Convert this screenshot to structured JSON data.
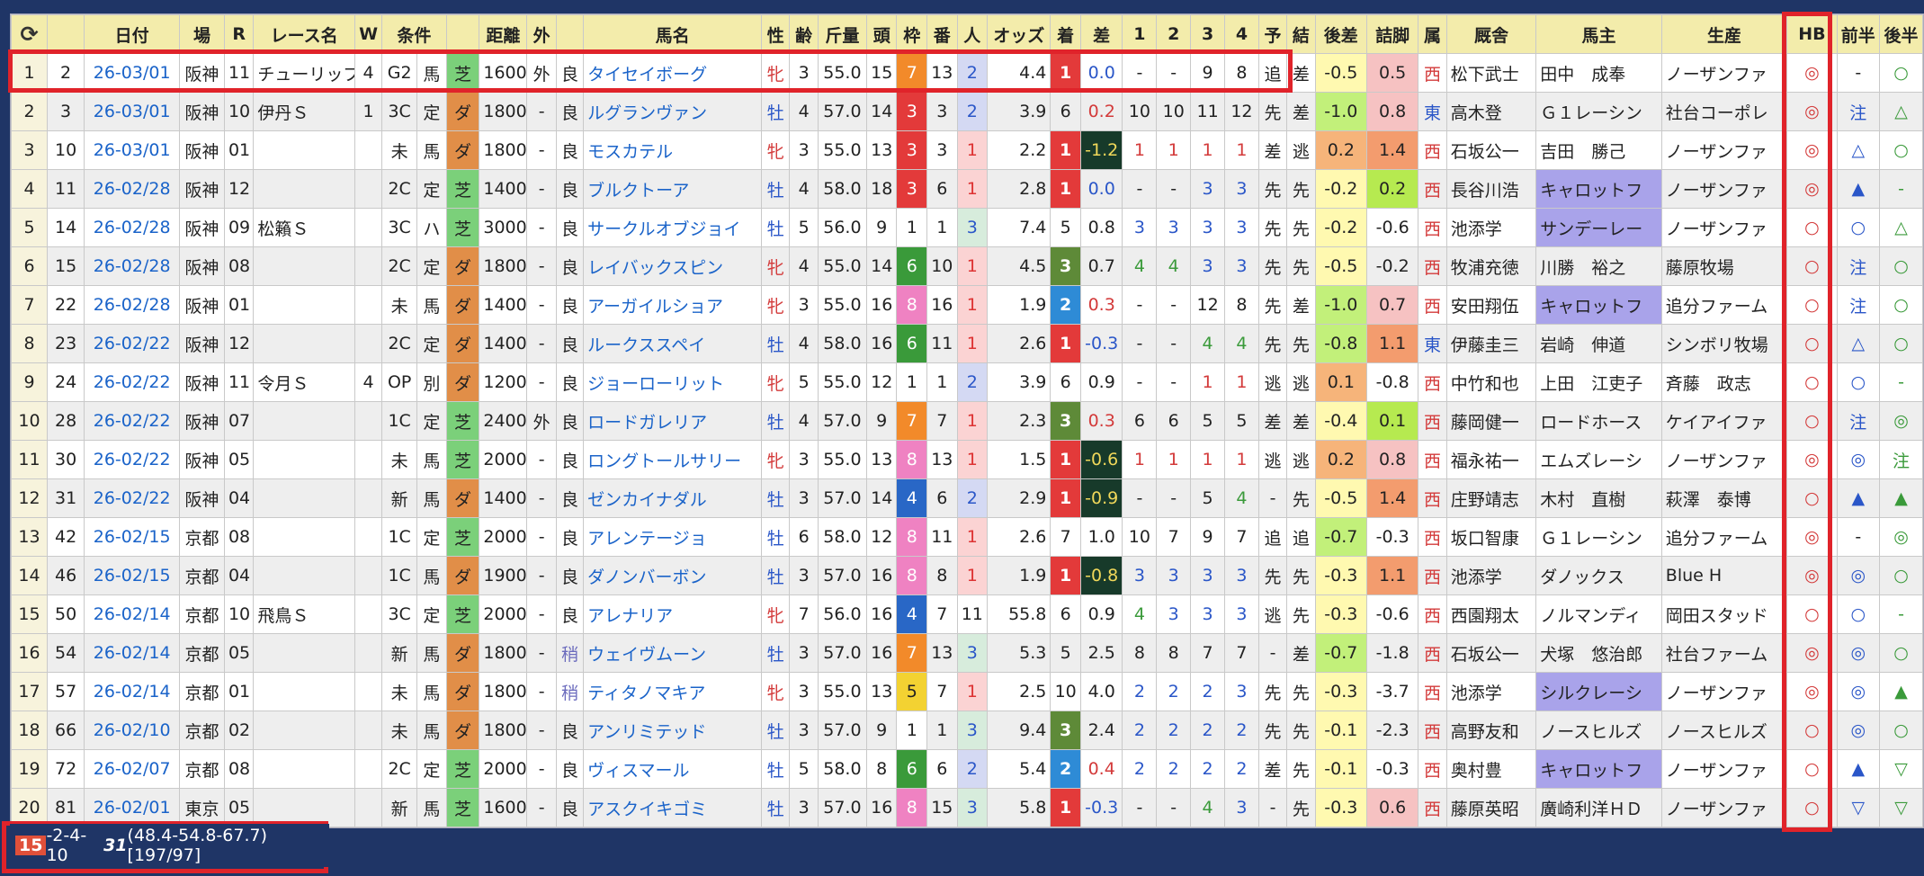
{
  "header": {
    "refresh_icon": "refresh-icon",
    "columns": [
      "日付",
      "場",
      "R",
      "レース名",
      "W",
      "条件",
      "",
      "距離",
      "外",
      "",
      "馬名",
      "性",
      "齢",
      "斤量",
      "頭",
      "枠",
      "番",
      "人",
      "オッズ",
      "着",
      "差",
      "1",
      "2",
      "3",
      "4",
      "予",
      "結",
      "後差",
      "詰脚",
      "属",
      "厩舎",
      "馬主",
      "生産",
      "HB",
      "前半",
      "後半"
    ]
  },
  "rows": [
    {
      "no": "1",
      "id": "2",
      "date": "26-03/01",
      "track": "阪神",
      "r": "11",
      "race": "チューリップ",
      "w": "4",
      "cls": "G2",
      "cond": "馬",
      "surf": "芝",
      "dist": "1600",
      "out": "外",
      "going": "良",
      "horse": "タイセイボーグ",
      "sex": "牝",
      "age": "3",
      "kin": "55.0",
      "heads": "15",
      "frame": "7",
      "num": "13",
      "pop": "2",
      "odds": "4.4",
      "fin": "1",
      "diff": "0.0",
      "p1": "-",
      "p2": "-",
      "p3": "9",
      "p4": "8",
      "yo": "追",
      "ke": "差",
      "kohsa": "-0.5",
      "tsume": "0.5",
      "zoku": "西",
      "stable": "松下武士",
      "owner": "田中　成奉",
      "breeder": "ノーザンファ",
      "hb": "◎",
      "zen": "-",
      "kou": "○"
    },
    {
      "no": "2",
      "id": "3",
      "date": "26-03/01",
      "track": "阪神",
      "r": "10",
      "race": "伊丹Ｓ",
      "w": "1",
      "cls": "3C",
      "cond": "定",
      "surf": "ダ",
      "dist": "1800",
      "out": "-",
      "going": "良",
      "horse": "ルグランヴァン",
      "sex": "牡",
      "age": "4",
      "kin": "57.0",
      "heads": "14",
      "frame": "3",
      "num": "3",
      "pop": "2",
      "odds": "3.9",
      "fin": "6",
      "diff": "0.2",
      "p1": "10",
      "p2": "10",
      "p3": "11",
      "p4": "12",
      "yo": "先",
      "ke": "差",
      "kohsa": "-1.0",
      "tsume": "0.8",
      "zoku": "東",
      "stable": "高木登",
      "owner": "Ｇ１レーシン",
      "breeder": "社台コーポレ",
      "hb": "◎",
      "zen": "注",
      "kou": "△"
    },
    {
      "no": "3",
      "id": "10",
      "date": "26-03/01",
      "track": "阪神",
      "r": "01",
      "race": "",
      "w": "",
      "cls": "未",
      "cond": "馬",
      "surf": "ダ",
      "dist": "1800",
      "out": "-",
      "going": "良",
      "horse": "モスカテル",
      "sex": "牝",
      "age": "3",
      "kin": "55.0",
      "heads": "13",
      "frame": "3",
      "num": "3",
      "pop": "1",
      "odds": "2.2",
      "fin": "1",
      "diff": "-1.2",
      "p1": "1",
      "p2": "1",
      "p3": "1",
      "p4": "1",
      "yo": "差",
      "ke": "逃",
      "kohsa": "0.2",
      "tsume": "1.4",
      "zoku": "西",
      "stable": "石坂公一",
      "owner": "吉田　勝己",
      "breeder": "ノーザンファ",
      "hb": "◎",
      "zen": "△",
      "kou": "○"
    },
    {
      "no": "4",
      "id": "11",
      "date": "26-02/28",
      "track": "阪神",
      "r": "12",
      "race": "",
      "w": "",
      "cls": "2C",
      "cond": "定",
      "surf": "芝",
      "dist": "1400",
      "out": "-",
      "going": "良",
      "horse": "ブルクトーア",
      "sex": "牡",
      "age": "4",
      "kin": "58.0",
      "heads": "18",
      "frame": "3",
      "num": "6",
      "pop": "1",
      "odds": "2.8",
      "fin": "1",
      "diff": "0.0",
      "p1": "-",
      "p2": "-",
      "p3": "3",
      "p4": "3",
      "yo": "先",
      "ke": "先",
      "kohsa": "-0.2",
      "tsume": "0.2",
      "zoku": "西",
      "stable": "長谷川浩",
      "owner": "キャロットフ",
      "breeder": "ノーザンファ",
      "hb": "◎",
      "zen": "▲",
      "kou": "-"
    },
    {
      "no": "5",
      "id": "14",
      "date": "26-02/28",
      "track": "阪神",
      "r": "09",
      "race": "松籟Ｓ",
      "w": "",
      "cls": "3C",
      "cond": "ハ",
      "surf": "芝",
      "dist": "3000",
      "out": "-",
      "going": "良",
      "horse": "サークルオブジョイ",
      "sex": "牡",
      "age": "5",
      "kin": "56.0",
      "heads": "9",
      "frame": "1",
      "num": "1",
      "pop": "3",
      "odds": "7.4",
      "fin": "5",
      "diff": "0.8",
      "p1": "3",
      "p2": "3",
      "p3": "3",
      "p4": "3",
      "yo": "先",
      "ke": "先",
      "kohsa": "-0.2",
      "tsume": "-0.6",
      "zoku": "西",
      "stable": "池添学",
      "owner": "サンデーレー",
      "breeder": "ノーザンファ",
      "hb": "○",
      "zen": "○",
      "kou": "△"
    },
    {
      "no": "6",
      "id": "15",
      "date": "26-02/28",
      "track": "阪神",
      "r": "08",
      "race": "",
      "w": "",
      "cls": "2C",
      "cond": "定",
      "surf": "ダ",
      "dist": "1800",
      "out": "-",
      "going": "良",
      "horse": "レイバックスピン",
      "sex": "牝",
      "age": "4",
      "kin": "55.0",
      "heads": "14",
      "frame": "6",
      "num": "10",
      "pop": "1",
      "odds": "4.5",
      "fin": "3",
      "diff": "0.7",
      "p1": "4",
      "p2": "4",
      "p3": "3",
      "p4": "3",
      "yo": "先",
      "ke": "先",
      "kohsa": "-0.5",
      "tsume": "-0.2",
      "zoku": "西",
      "stable": "牧浦充徳",
      "owner": "川勝　裕之",
      "breeder": "藤原牧場",
      "hb": "○",
      "zen": "注",
      "kou": "○"
    },
    {
      "no": "7",
      "id": "22",
      "date": "26-02/28",
      "track": "阪神",
      "r": "01",
      "race": "",
      "w": "",
      "cls": "未",
      "cond": "馬",
      "surf": "ダ",
      "dist": "1400",
      "out": "-",
      "going": "良",
      "horse": "アーガイルショア",
      "sex": "牝",
      "age": "3",
      "kin": "55.0",
      "heads": "16",
      "frame": "8",
      "num": "16",
      "pop": "1",
      "odds": "1.9",
      "fin": "2",
      "diff": "0.3",
      "p1": "-",
      "p2": "-",
      "p3": "12",
      "p4": "8",
      "yo": "先",
      "ke": "差",
      "kohsa": "-1.0",
      "tsume": "0.7",
      "zoku": "西",
      "stable": "安田翔伍",
      "owner": "キャロットフ",
      "breeder": "追分ファーム",
      "hb": "○",
      "zen": "注",
      "kou": "○"
    },
    {
      "no": "8",
      "id": "23",
      "date": "26-02/22",
      "track": "阪神",
      "r": "12",
      "race": "",
      "w": "",
      "cls": "2C",
      "cond": "定",
      "surf": "ダ",
      "dist": "1400",
      "out": "-",
      "going": "良",
      "horse": "ルークススペイ",
      "sex": "牡",
      "age": "4",
      "kin": "58.0",
      "heads": "16",
      "frame": "6",
      "num": "11",
      "pop": "1",
      "odds": "2.6",
      "fin": "1",
      "diff": "-0.3",
      "p1": "-",
      "p2": "-",
      "p3": "4",
      "p4": "4",
      "yo": "先",
      "ke": "先",
      "kohsa": "-0.8",
      "tsume": "1.1",
      "zoku": "東",
      "stable": "伊藤圭三",
      "owner": "岩崎　伸道",
      "breeder": "シンボリ牧場",
      "hb": "○",
      "zen": "△",
      "kou": "○"
    },
    {
      "no": "9",
      "id": "24",
      "date": "26-02/22",
      "track": "阪神",
      "r": "11",
      "race": "令月Ｓ",
      "w": "4",
      "cls": "OP",
      "cond": "別",
      "surf": "ダ",
      "dist": "1200",
      "out": "-",
      "going": "良",
      "horse": "ジョーローリット",
      "sex": "牝",
      "age": "5",
      "kin": "55.0",
      "heads": "12",
      "frame": "1",
      "num": "1",
      "pop": "2",
      "odds": "3.9",
      "fin": "6",
      "diff": "0.9",
      "p1": "-",
      "p2": "-",
      "p3": "1",
      "p4": "1",
      "yo": "逃",
      "ke": "逃",
      "kohsa": "0.1",
      "tsume": "-0.8",
      "zoku": "西",
      "stable": "中竹和也",
      "owner": "上田　江吏子",
      "breeder": "斉藤　政志",
      "hb": "○",
      "zen": "○",
      "kou": "-"
    },
    {
      "no": "10",
      "id": "28",
      "date": "26-02/22",
      "track": "阪神",
      "r": "07",
      "race": "",
      "w": "",
      "cls": "1C",
      "cond": "定",
      "surf": "芝",
      "dist": "2400",
      "out": "外",
      "going": "良",
      "horse": "ロードガレリア",
      "sex": "牡",
      "age": "4",
      "kin": "57.0",
      "heads": "9",
      "frame": "7",
      "num": "7",
      "pop": "1",
      "odds": "2.3",
      "fin": "3",
      "diff": "0.3",
      "p1": "6",
      "p2": "6",
      "p3": "5",
      "p4": "5",
      "yo": "差",
      "ke": "差",
      "kohsa": "-0.4",
      "tsume": "0.1",
      "zoku": "西",
      "stable": "藤岡健一",
      "owner": "ロードホース",
      "breeder": "ケイアイファ",
      "hb": "○",
      "zen": "注",
      "kou": "◎"
    },
    {
      "no": "11",
      "id": "30",
      "date": "26-02/22",
      "track": "阪神",
      "r": "05",
      "race": "",
      "w": "",
      "cls": "未",
      "cond": "馬",
      "surf": "芝",
      "dist": "2000",
      "out": "-",
      "going": "良",
      "horse": "ロングトールサリー",
      "sex": "牝",
      "age": "3",
      "kin": "55.0",
      "heads": "13",
      "frame": "8",
      "num": "13",
      "pop": "1",
      "odds": "1.5",
      "fin": "1",
      "diff": "-0.6",
      "p1": "1",
      "p2": "1",
      "p3": "1",
      "p4": "1",
      "yo": "逃",
      "ke": "逃",
      "kohsa": "0.2",
      "tsume": "0.8",
      "zoku": "西",
      "stable": "福永祐一",
      "owner": "エムズレーシ",
      "breeder": "ノーザンファ",
      "hb": "◎",
      "zen": "◎",
      "kou": "注"
    },
    {
      "no": "12",
      "id": "31",
      "date": "26-02/22",
      "track": "阪神",
      "r": "04",
      "race": "",
      "w": "",
      "cls": "新",
      "cond": "馬",
      "surf": "ダ",
      "dist": "1400",
      "out": "-",
      "going": "良",
      "horse": "ゼンカイナダル",
      "sex": "牡",
      "age": "3",
      "kin": "57.0",
      "heads": "14",
      "frame": "4",
      "num": "6",
      "pop": "2",
      "odds": "2.9",
      "fin": "1",
      "diff": "-0.9",
      "p1": "-",
      "p2": "-",
      "p3": "5",
      "p4": "4",
      "yo": "-",
      "ke": "先",
      "kohsa": "-0.5",
      "tsume": "1.4",
      "zoku": "西",
      "stable": "庄野靖志",
      "owner": "木村　直樹",
      "breeder": "萩澤　泰博",
      "hb": "○",
      "zen": "▲",
      "kou": "▲"
    },
    {
      "no": "13",
      "id": "42",
      "date": "26-02/15",
      "track": "京都",
      "r": "08",
      "race": "",
      "w": "",
      "cls": "1C",
      "cond": "定",
      "surf": "芝",
      "dist": "2000",
      "out": "-",
      "going": "良",
      "horse": "アレンテージョ",
      "sex": "牡",
      "age": "6",
      "kin": "58.0",
      "heads": "12",
      "frame": "8",
      "num": "11",
      "pop": "1",
      "odds": "2.6",
      "fin": "7",
      "diff": "1.0",
      "p1": "10",
      "p2": "7",
      "p3": "9",
      "p4": "7",
      "yo": "追",
      "ke": "追",
      "kohsa": "-0.7",
      "tsume": "-0.3",
      "zoku": "西",
      "stable": "坂口智康",
      "owner": "Ｇ１レーシン",
      "breeder": "追分ファーム",
      "hb": "◎",
      "zen": "-",
      "kou": "◎"
    },
    {
      "no": "14",
      "id": "46",
      "date": "26-02/15",
      "track": "京都",
      "r": "04",
      "race": "",
      "w": "",
      "cls": "1C",
      "cond": "馬",
      "surf": "ダ",
      "dist": "1900",
      "out": "-",
      "going": "良",
      "horse": "ダノンバーボン",
      "sex": "牡",
      "age": "3",
      "kin": "57.0",
      "heads": "16",
      "frame": "8",
      "num": "8",
      "pop": "1",
      "odds": "1.9",
      "fin": "1",
      "diff": "-0.8",
      "p1": "3",
      "p2": "3",
      "p3": "3",
      "p4": "3",
      "yo": "先",
      "ke": "先",
      "kohsa": "-0.3",
      "tsume": "1.1",
      "zoku": "西",
      "stable": "池添学",
      "owner": "ダノックス",
      "breeder": "Blue H",
      "hb": "◎",
      "zen": "◎",
      "kou": "○"
    },
    {
      "no": "15",
      "id": "50",
      "date": "26-02/14",
      "track": "京都",
      "r": "10",
      "race": "飛鳥Ｓ",
      "w": "",
      "cls": "3C",
      "cond": "定",
      "surf": "芝",
      "dist": "2000",
      "out": "-",
      "going": "良",
      "horse": "アレナリア",
      "sex": "牝",
      "age": "7",
      "kin": "56.0",
      "heads": "16",
      "frame": "4",
      "num": "7",
      "pop": "11",
      "odds": "55.8",
      "fin": "6",
      "diff": "0.9",
      "p1": "4",
      "p2": "3",
      "p3": "3",
      "p4": "3",
      "yo": "逃",
      "ke": "先",
      "kohsa": "-0.3",
      "tsume": "-0.6",
      "zoku": "西",
      "stable": "西園翔太",
      "owner": "ノルマンディ",
      "breeder": "岡田スタッド",
      "hb": "○",
      "zen": "○",
      "kou": "-"
    },
    {
      "no": "16",
      "id": "54",
      "date": "26-02/14",
      "track": "京都",
      "r": "05",
      "race": "",
      "w": "",
      "cls": "新",
      "cond": "馬",
      "surf": "ダ",
      "dist": "1800",
      "out": "-",
      "going": "稍",
      "horse": "ウェイヴムーン",
      "sex": "牡",
      "age": "3",
      "kin": "57.0",
      "heads": "16",
      "frame": "7",
      "num": "13",
      "pop": "3",
      "odds": "5.3",
      "fin": "5",
      "diff": "2.5",
      "p1": "8",
      "p2": "8",
      "p3": "7",
      "p4": "7",
      "yo": "-",
      "ke": "差",
      "kohsa": "-0.7",
      "tsume": "-1.8",
      "zoku": "西",
      "stable": "石坂公一",
      "owner": "犬塚　悠治郎",
      "breeder": "社台ファーム",
      "hb": "◎",
      "zen": "◎",
      "kou": "○"
    },
    {
      "no": "17",
      "id": "57",
      "date": "26-02/14",
      "track": "京都",
      "r": "01",
      "race": "",
      "w": "",
      "cls": "未",
      "cond": "馬",
      "surf": "ダ",
      "dist": "1800",
      "out": "-",
      "going": "稍",
      "horse": "ティタノマキア",
      "sex": "牝",
      "age": "3",
      "kin": "55.0",
      "heads": "13",
      "frame": "5",
      "num": "7",
      "pop": "1",
      "odds": "2.5",
      "fin": "10",
      "diff": "4.0",
      "p1": "2",
      "p2": "2",
      "p3": "2",
      "p4": "3",
      "yo": "先",
      "ke": "先",
      "kohsa": "-0.3",
      "tsume": "-3.7",
      "zoku": "西",
      "stable": "池添学",
      "owner": "シルクレーシ",
      "breeder": "ノーザンファ",
      "hb": "◎",
      "zen": "◎",
      "kou": "▲"
    },
    {
      "no": "18",
      "id": "66",
      "date": "26-02/10",
      "track": "京都",
      "r": "02",
      "race": "",
      "w": "",
      "cls": "未",
      "cond": "馬",
      "surf": "ダ",
      "dist": "1800",
      "out": "-",
      "going": "良",
      "horse": "アンリミテッド",
      "sex": "牡",
      "age": "3",
      "kin": "57.0",
      "heads": "9",
      "frame": "1",
      "num": "1",
      "pop": "3",
      "odds": "9.4",
      "fin": "3",
      "diff": "2.4",
      "p1": "2",
      "p2": "2",
      "p3": "2",
      "p4": "2",
      "yo": "先",
      "ke": "先",
      "kohsa": "-0.1",
      "tsume": "-2.3",
      "zoku": "西",
      "stable": "高野友和",
      "owner": "ノースヒルズ",
      "breeder": "ノースヒルズ",
      "hb": "○",
      "zen": "◎",
      "kou": "○"
    },
    {
      "no": "19",
      "id": "72",
      "date": "26-02/07",
      "track": "京都",
      "r": "08",
      "race": "",
      "w": "",
      "cls": "2C",
      "cond": "定",
      "surf": "芝",
      "dist": "2000",
      "out": "-",
      "going": "良",
      "horse": "ヴィスマール",
      "sex": "牡",
      "age": "5",
      "kin": "58.0",
      "heads": "8",
      "frame": "6",
      "num": "6",
      "pop": "2",
      "odds": "5.4",
      "fin": "2",
      "diff": "0.4",
      "p1": "2",
      "p2": "2",
      "p3": "2",
      "p4": "2",
      "yo": "差",
      "ke": "先",
      "kohsa": "-0.1",
      "tsume": "-0.3",
      "zoku": "西",
      "stable": "奥村豊",
      "owner": "キャロットフ",
      "breeder": "ノーザンファ",
      "hb": "○",
      "zen": "▲",
      "kou": "▽"
    },
    {
      "no": "20",
      "id": "81",
      "date": "26-02/01",
      "track": "東京",
      "r": "05",
      "race": "",
      "w": "",
      "cls": "新",
      "cond": "馬",
      "surf": "芝",
      "dist": "1600",
      "out": "-",
      "going": "良",
      "horse": "アスクイキゴミ",
      "sex": "牡",
      "age": "3",
      "kin": "57.0",
      "heads": "16",
      "frame": "8",
      "num": "15",
      "pop": "3",
      "odds": "5.8",
      "fin": "1",
      "diff": "-0.3",
      "p1": "-",
      "p2": "-",
      "p3": "4",
      "p4": "3",
      "yo": "-",
      "ke": "先",
      "kohsa": "-0.3",
      "tsume": "0.6",
      "zoku": "西",
      "stable": "藤原英昭",
      "owner": "廣崎利洋ＨＤ",
      "breeder": "ノーザンファ",
      "hb": "○",
      "zen": "▽",
      "kou": "▽"
    }
  ],
  "footer": {
    "first": "15",
    "rest": "-2-4-10 ",
    "total": "31",
    "stats": " (48.4-54.8-67.7) [197/97]"
  }
}
